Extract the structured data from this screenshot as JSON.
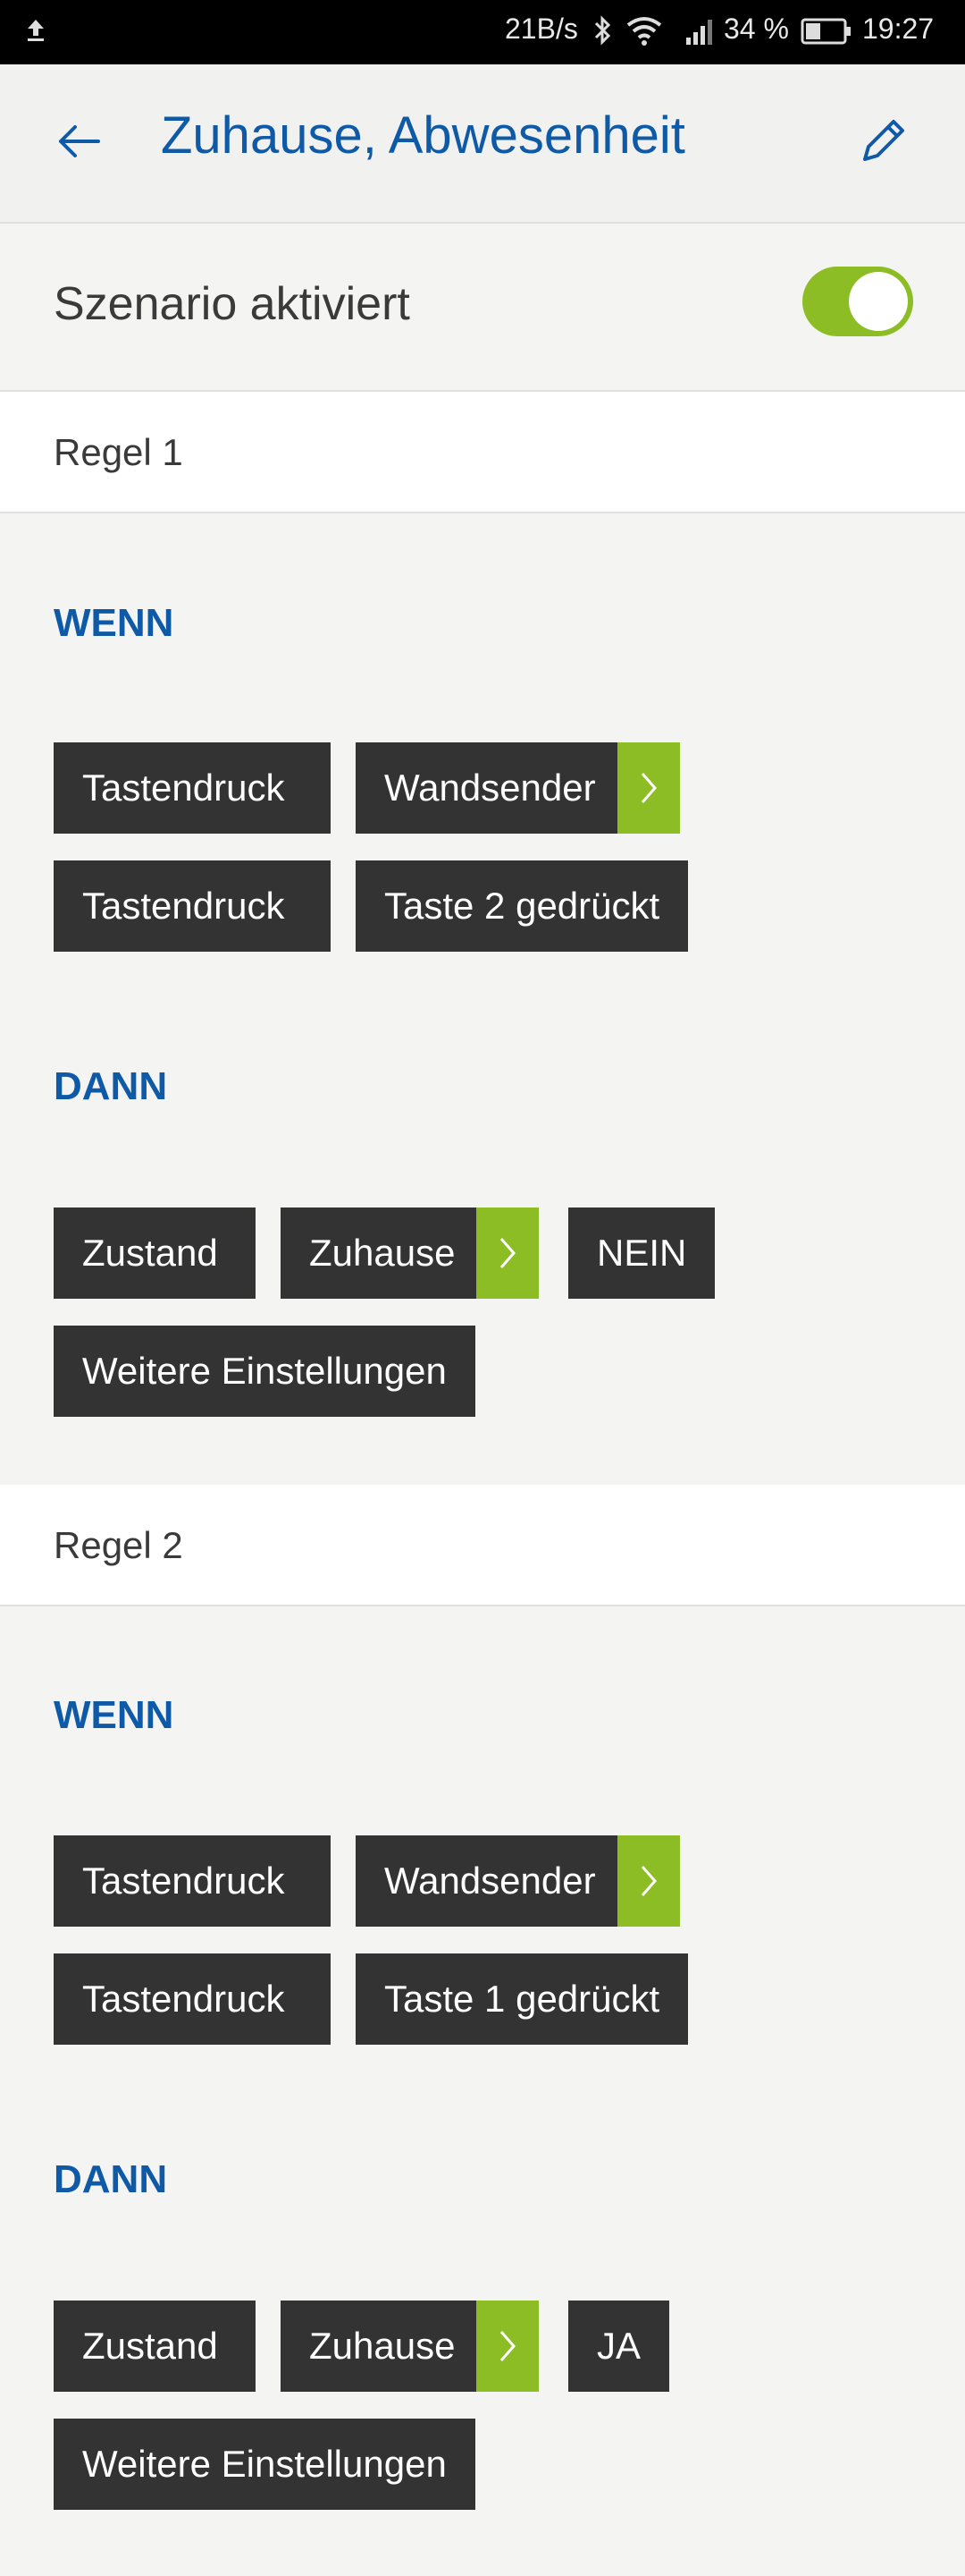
{
  "status_bar": {
    "speed": "21B/s",
    "battery_percent": "34 %",
    "time": "19:27"
  },
  "app_bar": {
    "title": "Zuhause, Abwesenheit"
  },
  "scenario": {
    "label": "Szenario aktiviert",
    "enabled": true,
    "accent_color": "#8cbd24"
  },
  "rules": [
    {
      "label": "Regel 1",
      "if_label": "WENN",
      "if_rows": [
        [
          "Tastendruck",
          "Wandsender"
        ],
        [
          "Tastendruck",
          "Taste 2 gedrückt"
        ]
      ],
      "then_label": "DANN",
      "then_row": [
        "Zustand",
        "Zuhause",
        "NEIN"
      ],
      "more_settings": "Weitere Einstellungen"
    },
    {
      "label": "Regel 2",
      "if_label": "WENN",
      "if_rows": [
        [
          "Tastendruck",
          "Wandsender"
        ],
        [
          "Tastendruck",
          "Taste 1 gedrückt"
        ]
      ],
      "then_label": "DANN",
      "then_row": [
        "Zustand",
        "Zuhause",
        "JA"
      ],
      "more_settings": "Weitere Einstellungen"
    }
  ]
}
